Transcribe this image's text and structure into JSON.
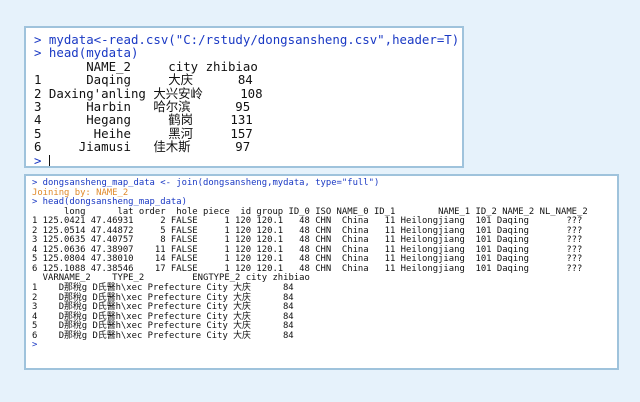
{
  "top_console": {
    "commands": [
      "> mydata<-read.csv(\"C:/rstudy/dongsansheng.csv\",header=T)",
      "> head(mydata)"
    ],
    "table_lines": [
      "       NAME_2     city zhibiao",
      "1      Daqing     大庆      84",
      "2 Daxing'anling 大兴安岭     108",
      "3      Harbin   哈尔滨      95",
      "4      Hegang     鹤岗     131",
      "5       Heihe     黑河     157",
      "6     Jiamusi   佳木斯      97"
    ],
    "prompt": "> "
  },
  "bottom_console": {
    "command1": "> dongsansheng_map_data <- join(dongsansheng,mydata, type=\"full\")",
    "message": "Joining by: NAME_2",
    "command2": "> head(dongsansheng_map_data)",
    "table_lines": [
      "      long      lat order  hole piece  id group ID_0 ISO NAME_0 ID_1        NAME_1 ID_2 NAME_2 NL_NAME_2",
      "1 125.0421 47.46931     2 FALSE     1 120 120.1   48 CHN  China   11 Heilongjiang  101 Daqing       ???",
      "2 125.0514 47.44872     5 FALSE     1 120 120.1   48 CHN  China   11 Heilongjiang  101 Daqing       ???",
      "3 125.0635 47.40757     8 FALSE     1 120 120.1   48 CHN  China   11 Heilongjiang  101 Daqing       ???",
      "4 125.0636 47.38907    11 FALSE     1 120 120.1   48 CHN  China   11 Heilongjiang  101 Daqing       ???",
      "5 125.0804 47.38010    14 FALSE     1 120 120.1   48 CHN  China   11 Heilongjiang  101 Daqing       ???",
      "6 125.1088 47.38546    17 FALSE     1 120 120.1   48 CHN  China   11 Heilongjiang  101 Daqing       ???",
      "  VARNAME_2    TYPE_2         ENGTYPE_2 city zhibiao",
      "1    D那稅g D氏醫h\\xec Prefecture City 大庆      84",
      "2    D那稅g D氏醫h\\xec Prefecture City 大庆      84",
      "3    D那稅g D氏醫h\\xec Prefecture City 大庆      84",
      "4    D那稅g D氏醫h\\xec Prefecture City 大庆      84",
      "5    D那稅g D氏醫h\\xec Prefecture City 大庆      84",
      "6    D那稅g D氏醫h\\xec Prefecture City 大庆      84"
    ],
    "prompt": ">"
  },
  "colors": {
    "background": "#e6f2fb",
    "panel_border": "#9fc3dc",
    "command": "#1a39c4",
    "message": "#e08a2b",
    "output": "#111111"
  }
}
